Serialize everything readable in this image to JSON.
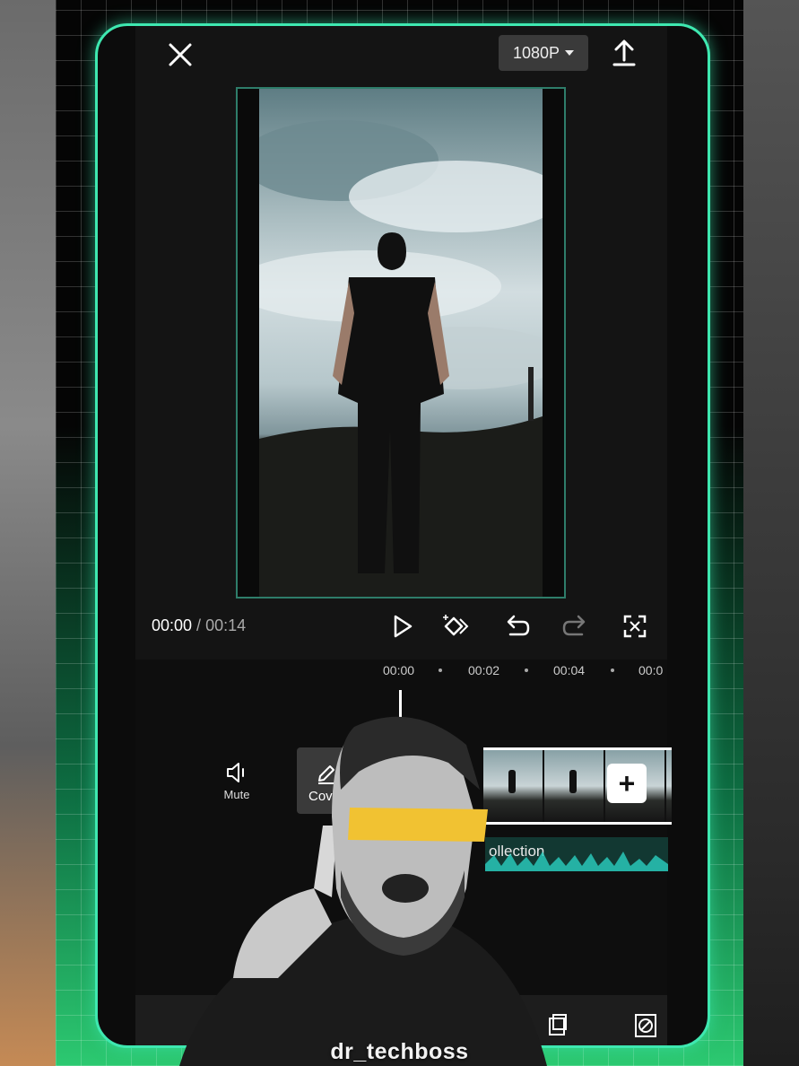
{
  "header": {
    "resolution_label": "1080P"
  },
  "player": {
    "current_time": "00:00",
    "separator": " / ",
    "duration": "00:14"
  },
  "timeline": {
    "ticks": [
      "00:00",
      "00:02",
      "00:04",
      "00:0"
    ],
    "mute_label": "Mute",
    "cover_label": "Cover",
    "add_label": "+",
    "audio_track_label": "ollection"
  },
  "watermark": "dr_techboss",
  "colors": {
    "accent": "#3ee8b0",
    "audio_wave": "#2ad0c0",
    "background": "#141414"
  },
  "icons": {
    "close": "close-icon",
    "export": "export-icon",
    "play": "play-icon",
    "keyframe": "keyframe-icon",
    "undo": "undo-icon",
    "redo": "redo-icon",
    "fullscreen": "fullscreen-icon",
    "mute": "speaker-icon",
    "cover": "pencil-icon"
  }
}
